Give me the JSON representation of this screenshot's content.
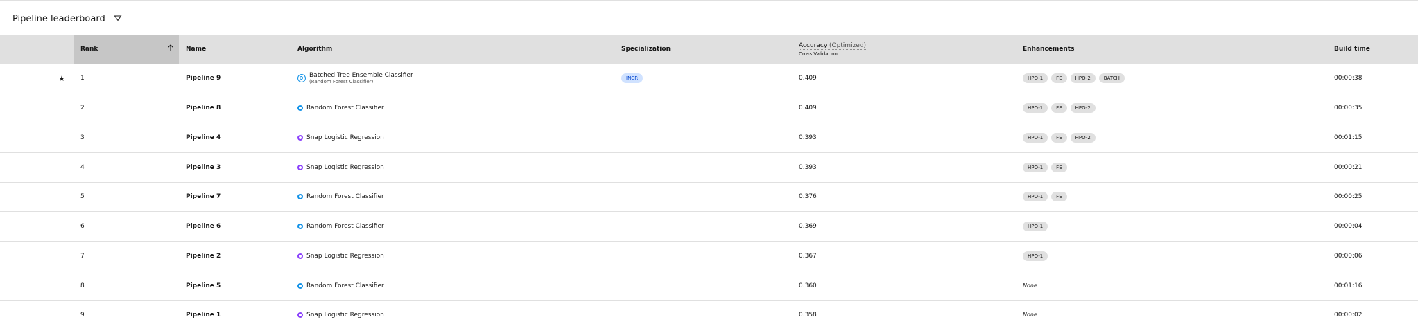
{
  "page": {
    "title": "Pipeline leaderboard"
  },
  "columns": {
    "rank": "Rank",
    "name": "Name",
    "algorithm": "Algorithm",
    "specialization": "Specialization",
    "accuracy": "Accuracy",
    "accuracy_optimized": "(Optimized)",
    "cross_validation": "Cross Validation",
    "enhancements": "Enhancements",
    "build_time": "Build time"
  },
  "rows": [
    {
      "rank": "1",
      "name": "Pipeline 9",
      "algorithm": "Batched Tree Ensemble Classifier",
      "algorithm_sub": "(Random Forest Classifier)",
      "algorithm_icon": "batched-tree-icon",
      "specialization": "INCR",
      "accuracy": "0.409",
      "enhancements": [
        "HPO-1",
        "FE",
        "HPO-2",
        "BATCH"
      ],
      "build_time": "00:00:38"
    },
    {
      "rank": "2",
      "name": "Pipeline 8",
      "algorithm": "Random Forest Classifier",
      "algorithm_icon": "random-forest-icon",
      "accuracy": "0.409",
      "enhancements": [
        "HPO-1",
        "FE",
        "HPO-2"
      ],
      "build_time": "00:00:35"
    },
    {
      "rank": "3",
      "name": "Pipeline 4",
      "algorithm": "Snap Logistic Regression",
      "algorithm_icon": "logistic-regression-icon",
      "accuracy": "0.393",
      "enhancements": [
        "HPO-1",
        "FE",
        "HPO-2"
      ],
      "build_time": "00:01:15"
    },
    {
      "rank": "4",
      "name": "Pipeline 3",
      "algorithm": "Snap Logistic Regression",
      "algorithm_icon": "logistic-regression-icon",
      "accuracy": "0.393",
      "enhancements": [
        "HPO-1",
        "FE"
      ],
      "build_time": "00:00:21"
    },
    {
      "rank": "5",
      "name": "Pipeline 7",
      "algorithm": "Random Forest Classifier",
      "algorithm_icon": "random-forest-icon",
      "accuracy": "0.376",
      "enhancements": [
        "HPO-1",
        "FE"
      ],
      "build_time": "00:00:25"
    },
    {
      "rank": "6",
      "name": "Pipeline 6",
      "algorithm": "Random Forest Classifier",
      "algorithm_icon": "random-forest-icon",
      "accuracy": "0.369",
      "enhancements": [
        "HPO-1"
      ],
      "build_time": "00:00:04"
    },
    {
      "rank": "7",
      "name": "Pipeline 2",
      "algorithm": "Snap Logistic Regression",
      "algorithm_icon": "logistic-regression-icon",
      "accuracy": "0.367",
      "enhancements": [
        "HPO-1"
      ],
      "build_time": "00:00:06"
    },
    {
      "rank": "8",
      "name": "Pipeline 5",
      "algorithm": "Random Forest Classifier",
      "algorithm_icon": "random-forest-icon",
      "accuracy": "0.360",
      "enhancements": [],
      "enhancements_none": "None",
      "build_time": "00:01:16"
    },
    {
      "rank": "9",
      "name": "Pipeline 1",
      "algorithm": "Snap Logistic Regression",
      "algorithm_icon": "logistic-regression-icon",
      "accuracy": "0.358",
      "enhancements": [],
      "enhancements_none": "None",
      "build_time": "00:00:02"
    }
  ],
  "colors": {
    "header_bg": "#e0e0e0",
    "sorted_header_bg": "#c6c6c6",
    "random_forest": "#1192e8",
    "logistic_regression": "#8a3ffc",
    "spec_tag_bg": "#d0e2ff",
    "spec_tag_text": "#0043ce",
    "enh_tag_bg": "#e0e0e0"
  }
}
